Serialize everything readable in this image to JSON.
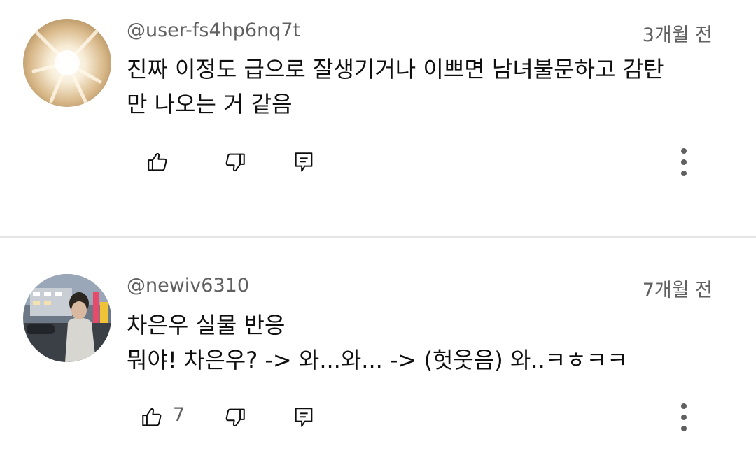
{
  "comments": [
    {
      "handle": "@user-fs4hp6nq7t",
      "time": "3개월 전",
      "lines": [
        "진짜 이정도 급으로 잘생기거나 이쁘면 남녀불문하고 감탄",
        "만 나오는 거 같음"
      ],
      "like_count": "",
      "icons": {
        "like": "thumb-up-icon",
        "dislike": "thumb-down-icon",
        "reply": "reply-icon",
        "more": "more-vertical-icon"
      }
    },
    {
      "handle": "@newiv6310",
      "time": "7개월 전",
      "lines": [
        "차은우 실물 반응",
        "뭐야! 차은우? -> 와...와... -> (헛웃음) 와..ㅋㅎㅋㅋ"
      ],
      "like_count": "7",
      "icons": {
        "like": "thumb-up-icon",
        "dislike": "thumb-down-icon",
        "reply": "reply-icon",
        "more": "more-vertical-icon"
      }
    }
  ],
  "colors": {
    "text_primary": "#0f0f0f",
    "text_secondary": "#606060",
    "divider": "#e5e5e5"
  }
}
